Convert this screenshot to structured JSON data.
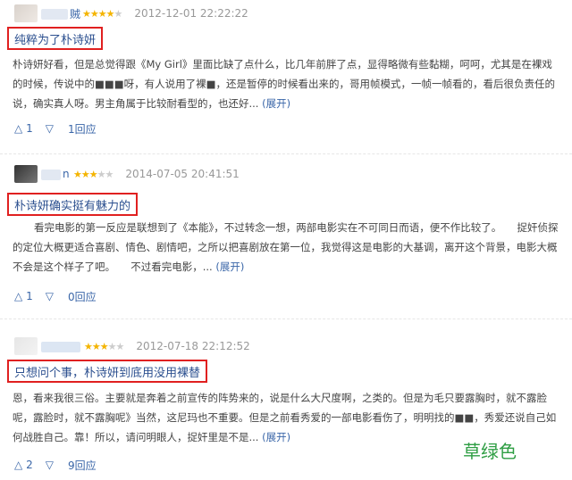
{
  "reviews": [
    {
      "username": "贼",
      "rating": 4,
      "time": "2012-12-01 22:22:22",
      "title": "纯粹为了朴诗妍",
      "body": "朴诗妍好看，但是总觉得跟《My Girl》里面比缺了点什么，比几年前胖了点，显得略微有些黏糊，呵呵，尤其是在裸戏的时候，传说中的■■■呀，有人说用了裸■，还是暂停的时候看出来的，哥用帧模式，一帧一帧看的，看后很负责任的说，确实真人呀。男主角属于比较耐看型的，也还好...",
      "expand": "(展开)",
      "up_votes": "1",
      "replies": "1回应"
    },
    {
      "username": "n",
      "rating": 3,
      "time": "2014-07-05 20:41:51",
      "title": "朴诗妍确实挺有魅力的",
      "body": "看完电影的第一反应是联想到了《本能》，不过转念一想，两部电影实在不可同日而语，便不作比较了。　　捉奸侦探的定位大概更适合喜剧、情色、剧情吧，之所以把喜剧放在第一位，我觉得这是电影的大基调，离开这个背景，电影大概不会是这个样子了吧。　　不过看完电影，...",
      "expand": "(展开)",
      "up_votes": "1",
      "replies": "0回应"
    },
    {
      "username": "",
      "rating": 3,
      "time": "2012-07-18 22:12:52",
      "title": "只想问个事，朴诗妍到底用没用裸替",
      "body": "恩，看来我很三俗。主要就是奔着之前宣传的阵势来的，说是什么大尺度啊，之类的。但是为毛只要露胸时，就不露脸呢，露脸时，就不露胸呢》当然，这尼玛也不重要。但是之前看秀爱的一部电影看伤了，明明找的■■，秀爱还说自己如何战胜自己。靠！所以，请问明眼人，捉奸里是不是...",
      "expand": "(展开)",
      "up_votes": "2",
      "replies": "9回应"
    }
  ],
  "icons": {
    "up": "up-triangle-icon",
    "down": "down-triangle-icon"
  },
  "watermark": "草绿色"
}
